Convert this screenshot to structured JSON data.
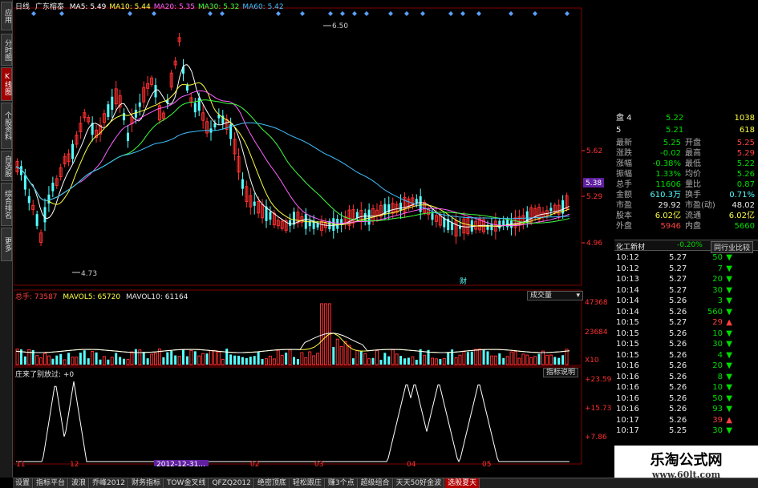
{
  "left_tabs": [
    {
      "label": "应用",
      "active": false
    },
    {
      "label": "分时图",
      "active": false
    },
    {
      "label": "K线图",
      "active": true
    },
    {
      "label": "个股资料",
      "active": false
    },
    {
      "label": "自选股",
      "active": false
    },
    {
      "label": "综合排名",
      "active": false
    },
    {
      "label": "更多",
      "active": false
    }
  ],
  "header": {
    "period": "日线",
    "stock": "广东榕泰",
    "ma": [
      {
        "label": "MA5: 5.49",
        "color": "#ffffff"
      },
      {
        "label": "MA10: 5.44",
        "color": "#ffff40"
      },
      {
        "label": "MA20: 5.35",
        "color": "#ff60ff"
      },
      {
        "label": "MA30: 5.32",
        "color": "#40ff40"
      },
      {
        "label": "MA60: 5.42",
        "color": "#40c0ff"
      }
    ]
  },
  "price_panel": {
    "high_label": "6.50",
    "low_label": "4.73",
    "axis_labels": [
      "5.62",
      "5.29",
      "4.96"
    ],
    "current_price_tag": "5.38",
    "fin_marker": "财",
    "colors": {
      "up": "#ff3030",
      "down": "#55ffff",
      "axis": "#ff3030",
      "grid": "#800000"
    }
  },
  "volume_panel": {
    "legend_total_label": "总手: 73587",
    "legend_ma5": "MAVOL5: 65720",
    "legend_ma10": "MAVOL10: 61164",
    "dropdown": "成交量",
    "axis_labels": [
      "47368",
      "23684",
      "X10"
    ]
  },
  "indicator_panel": {
    "title": "庄来了别放过: +0",
    "button": "指标说明",
    "axis_labels": [
      "+23.59",
      "+15.73",
      "+7.86"
    ]
  },
  "date_axis": {
    "labels": [
      "11",
      "12",
      "02",
      "03",
      "04",
      "05"
    ],
    "highlight": "2012-12-31..."
  },
  "quote": {
    "order_book": [
      {
        "label": "盘 4",
        "price": "5.22",
        "vol": "1038"
      },
      {
        "label": "5",
        "price": "5.21",
        "vol": "618"
      }
    ],
    "rows": [
      {
        "l1": "最新",
        "v1": "5.25",
        "c1": "green",
        "l2": "开盘",
        "v2": "5.25",
        "c2": "red"
      },
      {
        "l1": "涨跌",
        "v1": "-0.02",
        "c1": "green",
        "l2": "最高",
        "v2": "5.29",
        "c2": "red"
      },
      {
        "l1": "涨幅",
        "v1": "-0.38%",
        "c1": "green",
        "l2": "最低",
        "v2": "5.22",
        "c2": "green"
      },
      {
        "l1": "振幅",
        "v1": "1.33%",
        "c1": "green",
        "l2": "均价",
        "v2": "5.26",
        "c2": "green"
      },
      {
        "l1": "总手",
        "v1": "11606",
        "c1": "green",
        "l2": "量比",
        "v2": "0.87",
        "c2": "green"
      },
      {
        "l1": "金额",
        "v1": "610.3万",
        "c1": "cyan",
        "l2": "换手",
        "v2": "0.71%",
        "c2": "cyan"
      },
      {
        "l1": "市盈",
        "v1": "29.92",
        "c1": "white",
        "l2": "市盈(动)",
        "v2": "48.02",
        "c2": "white"
      },
      {
        "l1": "股本",
        "v1": "6.02亿",
        "c1": "yellow",
        "l2": "流通",
        "v2": "6.02亿",
        "c2": "yellow"
      },
      {
        "l1": "外盘",
        "v1": "5946",
        "c1": "red",
        "l2": "内盘",
        "v2": "5660",
        "c2": "green"
      }
    ],
    "sector": "化工新材",
    "sector_change": "-0.20%",
    "compare_button": "同行业比较"
  },
  "ticks": [
    {
      "time": "10:12",
      "price": "5.27",
      "vol": "50",
      "dir": "down"
    },
    {
      "time": "10:12",
      "price": "5.27",
      "vol": "7",
      "dir": "down"
    },
    {
      "time": "10:13",
      "price": "5.27",
      "vol": "20",
      "dir": "down"
    },
    {
      "time": "10:14",
      "price": "5.27",
      "vol": "30",
      "dir": "down"
    },
    {
      "time": "10:14",
      "price": "5.26",
      "vol": "3",
      "dir": "down"
    },
    {
      "time": "10:14",
      "price": "5.26",
      "vol": "560",
      "dir": "down"
    },
    {
      "time": "10:15",
      "price": "5.27",
      "vol": "29",
      "dir": "up"
    },
    {
      "time": "10:15",
      "price": "5.26",
      "vol": "10",
      "dir": "down"
    },
    {
      "time": "10:15",
      "price": "5.26",
      "vol": "30",
      "dir": "down"
    },
    {
      "time": "10:15",
      "price": "5.26",
      "vol": "4",
      "dir": "down"
    },
    {
      "time": "10:16",
      "price": "5.26",
      "vol": "20",
      "dir": "down"
    },
    {
      "time": "10:16",
      "price": "5.26",
      "vol": "8",
      "dir": "down"
    },
    {
      "time": "10:16",
      "price": "5.26",
      "vol": "10",
      "dir": "down"
    },
    {
      "time": "10:16",
      "price": "5.26",
      "vol": "50",
      "dir": "down"
    },
    {
      "time": "10:16",
      "price": "5.26",
      "vol": "93",
      "dir": "down"
    },
    {
      "time": "10:17",
      "price": "5.26",
      "vol": "39",
      "dir": "up"
    },
    {
      "time": "10:17",
      "price": "5.25",
      "vol": "30",
      "dir": "down"
    }
  ],
  "bottom_tabs": [
    {
      "label": "设置",
      "active": false
    },
    {
      "label": "指标平台",
      "active": false
    },
    {
      "label": "波浪",
      "active": false
    },
    {
      "label": "乔峰2012",
      "active": false
    },
    {
      "label": "财务指标",
      "active": false
    },
    {
      "label": "TOW金叉线",
      "active": false
    },
    {
      "label": "QFZQ2012",
      "active": false
    },
    {
      "label": "绝密顶底",
      "active": false
    },
    {
      "label": "轻松跟庄",
      "active": false
    },
    {
      "label": "赚3个点",
      "active": false
    },
    {
      "label": "超级组合",
      "active": false
    },
    {
      "label": "天天50好金波",
      "active": false
    },
    {
      "label": "选股夏天",
      "active": true
    }
  ],
  "watermark": {
    "title": "乐淘公式网",
    "url": "www.60lt.com"
  }
}
